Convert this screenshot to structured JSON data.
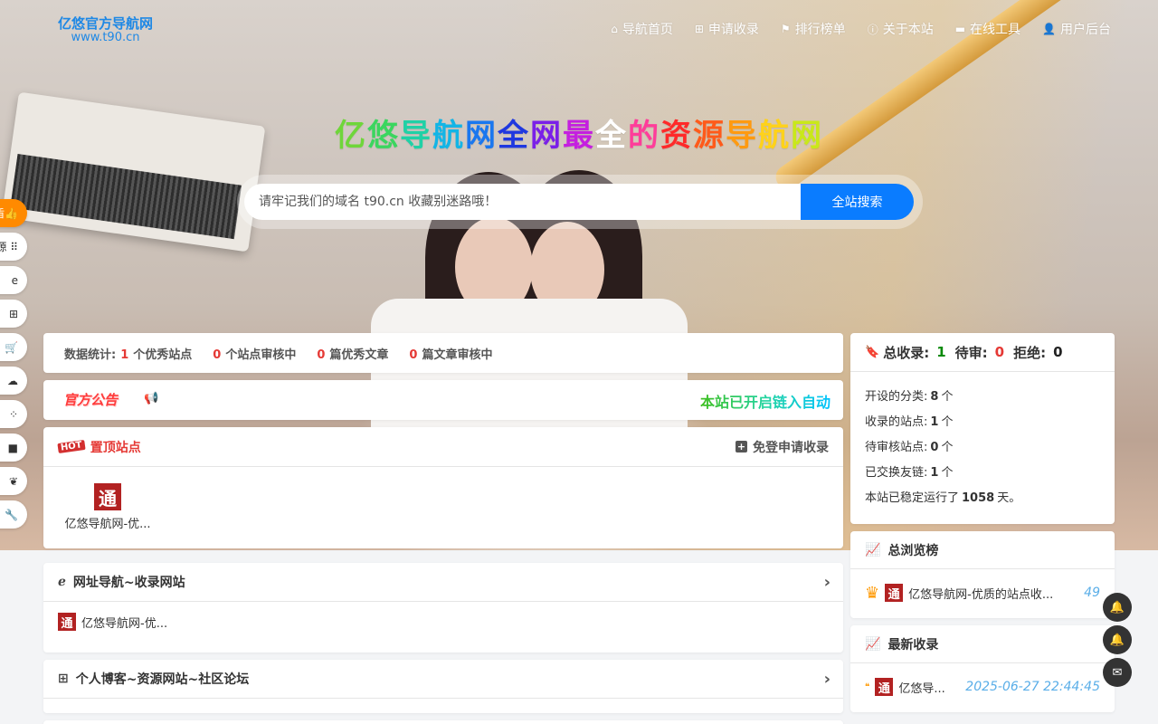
{
  "header": {
    "logo_title": "亿悠官方导航网",
    "logo_url": "www.t90.cn",
    "nav": [
      {
        "icon": "home-icon",
        "glyph": "⌂",
        "label": "导航首页"
      },
      {
        "icon": "plus-square-icon",
        "glyph": "⊞",
        "label": "申请收录"
      },
      {
        "icon": "flag-icon",
        "glyph": "⚑",
        "label": "排行榜单"
      },
      {
        "icon": "info-icon",
        "glyph": "ⓘ",
        "label": "关于本站"
      },
      {
        "icon": "folder-icon",
        "glyph": "▬",
        "label": "在线工具"
      },
      {
        "icon": "user-icon",
        "glyph": "👤",
        "label": "用户后台"
      }
    ]
  },
  "hero": {
    "slogan_chars": [
      "亿",
      "悠",
      "导",
      "航",
      "网",
      "全",
      "网",
      "最",
      "全",
      "的",
      "资",
      "源",
      "导",
      "航",
      "网"
    ],
    "slogan_colors": [
      "#6fd63a",
      "#3bd65f",
      "#20d1a6",
      "#12b5e6",
      "#1a77ef",
      "#1f38e0",
      "#7a1fe8",
      "#c51fe0",
      "#ffffff",
      "#ff3d9a",
      "#ff2a2a",
      "#ff5a1a",
      "#ff9a10",
      "#ffd21a",
      "#c9e81a"
    ],
    "search_placeholder": "请牢记我们的域名 t90.cn 收藏别迷路哦！",
    "search_button": "全站搜索"
  },
  "left_bar": {
    "items": [
      {
        "icon": "thumbs-up-icon",
        "glyph": "盾👍"
      },
      {
        "icon": "grid-icon",
        "glyph": "源 ⠿"
      },
      {
        "icon": "ie-icon",
        "glyph": "e"
      },
      {
        "icon": "windows-icon",
        "glyph": "⊞"
      },
      {
        "icon": "cart-icon",
        "glyph": "🛒"
      },
      {
        "icon": "cloud-icon",
        "glyph": "☁"
      },
      {
        "icon": "spinner-icon",
        "glyph": "⁘"
      },
      {
        "icon": "video-icon",
        "glyph": "■"
      },
      {
        "icon": "leaf-icon",
        "glyph": "❦"
      },
      {
        "icon": "wrench-icon",
        "glyph": "🔧"
      }
    ]
  },
  "stats": {
    "label": "数据统计:",
    "items": [
      {
        "num": "1",
        "text": "个优秀站点"
      },
      {
        "num": "0",
        "text": "个站点审核中"
      },
      {
        "num": "0",
        "text": "篇优秀文章"
      },
      {
        "num": "0",
        "text": "篇文章审核中"
      }
    ]
  },
  "notice": {
    "label": "官方公告",
    "marquee": "本站已开启链入自动"
  },
  "pinned": {
    "badge": "HOT",
    "title": "置顶站点",
    "action": "免登申请收录",
    "site_icon": "通",
    "site_name": "亿悠导航网-优..."
  },
  "sections": [
    {
      "icon": "ie-icon",
      "title": "网址导航~收录网站",
      "items": [
        {
          "icon": "通",
          "name": "亿悠导航网-优..."
        }
      ]
    },
    {
      "icon": "windows-icon",
      "title": "个人博客~资源网站~社区论坛",
      "items": []
    }
  ],
  "total": {
    "label": "总收录:",
    "total": "1",
    "pending_label": "待审:",
    "pending": "0",
    "reject_label": "拒绝:",
    "reject": "0",
    "lines": [
      {
        "pre": "开设的分类:",
        "val": "8",
        "post": "个"
      },
      {
        "pre": "收录的站点:",
        "val": "1",
        "post": "个"
      },
      {
        "pre": "待审核站点:",
        "val": "0",
        "post": "个"
      },
      {
        "pre": "已交换友链:",
        "val": "1",
        "post": "个"
      },
      {
        "pre": "本站已稳定运行了",
        "val": "1058",
        "post": "天。"
      }
    ]
  },
  "rank": {
    "title": "总浏览榜",
    "row_icon": "通",
    "row_name": "亿悠导航网-优质的站点收...",
    "row_value": "49"
  },
  "latest": {
    "title": "最新收录",
    "row_icon": "通",
    "row_name": "亿悠导...",
    "row_time": "2025-06-27 22:44:45"
  },
  "colors": {
    "accent": "#0a7cff",
    "red": "#e53935",
    "green": "#0b8a0b",
    "orange": "#ff8a00"
  }
}
